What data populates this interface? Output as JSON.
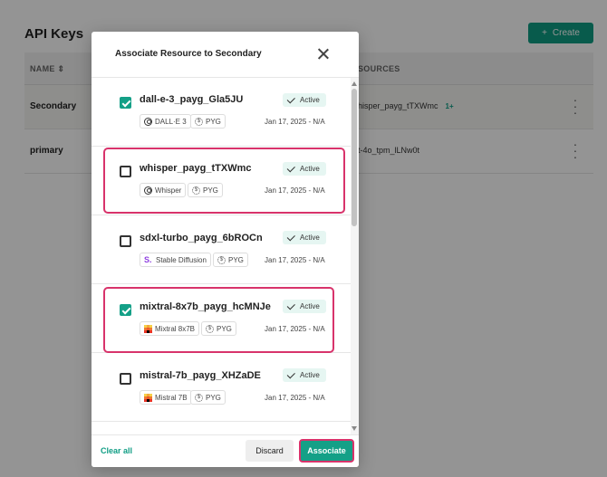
{
  "background": {
    "title": "API Keys",
    "create_label": "Create",
    "table": {
      "col_name": "NAME",
      "col_resources": "SOURCES",
      "rows": [
        {
          "name": "Secondary",
          "resource": "hisper_payg_tTXWmc",
          "badge": "1+"
        },
        {
          "name": "primary",
          "resource": "t-4o_tpm_lLNw0t",
          "badge": ""
        }
      ]
    }
  },
  "modal": {
    "title": "Associate Resource to Secondary",
    "items": [
      {
        "name": "dall-e-3_payg_Gla5JU",
        "status": "Active",
        "model": "DALL·E 3",
        "model_icon": "openai-icon",
        "billing": "PYG",
        "date": "Jan 17, 2025 - N/A",
        "checked": true,
        "highlighted": false
      },
      {
        "name": "whisper_payg_tTXWmc",
        "status": "Active",
        "model": "Whisper",
        "model_icon": "openai-icon",
        "billing": "PYG",
        "date": "Jan 17, 2025 - N/A",
        "checked": false,
        "highlighted": true
      },
      {
        "name": "sdxl-turbo_payg_6bROCn",
        "status": "Active",
        "model": "Stable Diffusion",
        "model_icon": "stable-diffusion-icon",
        "billing": "PYG",
        "date": "Jan 17, 2025 - N/A",
        "checked": false,
        "highlighted": false
      },
      {
        "name": "mixtral-8x7b_payg_hcMNJe",
        "status": "Active",
        "model": "Mixtral 8x7B",
        "model_icon": "mistral-icon",
        "billing": "PYG",
        "date": "Jan 17, 2025 - N/A",
        "checked": true,
        "highlighted": true
      },
      {
        "name": "mistral-7b_payg_XHZaDE",
        "status": "Active",
        "model": "Mistral 7B",
        "model_icon": "mistral-icon",
        "billing": "PYG",
        "date": "Jan 17, 2025 - N/A",
        "checked": false,
        "highlighted": false
      }
    ],
    "footer": {
      "clear_all": "Clear all",
      "discard": "Discard",
      "associate": "Associate"
    }
  },
  "colors": {
    "accent": "#14a087",
    "highlight": "#d8336b",
    "status_bg": "#e6f6f2"
  }
}
